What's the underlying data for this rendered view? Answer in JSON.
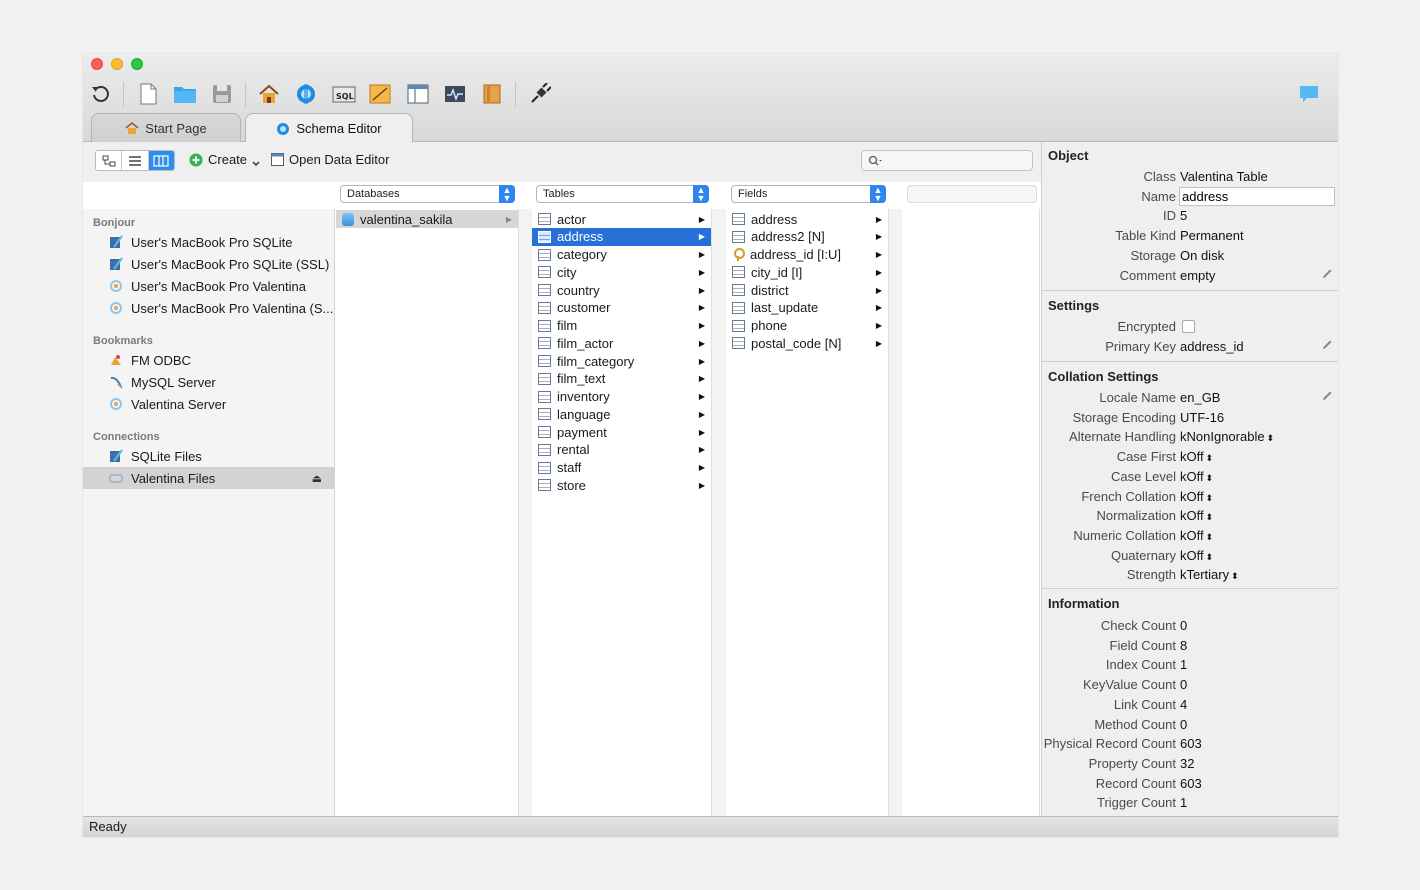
{
  "status": "Ready",
  "tabs": {
    "start": "Start Page",
    "schema": "Schema Editor"
  },
  "subtoolbar": {
    "create": "Create",
    "open_data_editor": "Open Data Editor",
    "search_placeholder": ""
  },
  "dropdowns": {
    "databases": "Databases",
    "tables": "Tables",
    "fields": "Fields"
  },
  "sidebar": {
    "sections": {
      "bonjour": "Bonjour",
      "bookmarks": "Bookmarks",
      "connections": "Connections"
    },
    "bonjour_items": [
      "User's MacBook Pro SQLite",
      "User's MacBook Pro SQLite (SSL)",
      "User's MacBook Pro Valentina",
      "User's MacBook Pro Valentina (S..."
    ],
    "bookmark_items": [
      "FM ODBC",
      "MySQL Server",
      "Valentina Server"
    ],
    "connection_items": [
      "SQLite Files",
      "Valentina Files"
    ]
  },
  "databases": [
    "valentina_sakila"
  ],
  "tables": [
    "actor",
    "address",
    "category",
    "city",
    "country",
    "customer",
    "film",
    "film_actor",
    "film_category",
    "film_text",
    "inventory",
    "language",
    "payment",
    "rental",
    "staff",
    "store"
  ],
  "fields": [
    "address",
    "address2 [N]",
    "address_id [I:U]",
    "city_id [I]",
    "district",
    "last_update",
    "phone",
    "postal_code [N]"
  ],
  "inspector": {
    "object_title": "Object",
    "object": [
      {
        "k": "Class",
        "v": "Valentina Table"
      },
      {
        "k": "Name",
        "v": "address"
      },
      {
        "k": "ID",
        "v": "5"
      },
      {
        "k": "Table Kind",
        "v": "Permanent"
      },
      {
        "k": "Storage",
        "v": "On disk"
      },
      {
        "k": "Comment",
        "v": "empty"
      }
    ],
    "settings_title": "Settings",
    "settings": [
      {
        "k": "Encrypted",
        "v": ""
      },
      {
        "k": "Primary Key",
        "v": "address_id"
      }
    ],
    "collation_title": "Collation Settings",
    "collation": [
      {
        "k": "Locale Name",
        "v": "en_GB"
      },
      {
        "k": "Storage Encoding",
        "v": "UTF-16"
      },
      {
        "k": "Alternate Handling",
        "v": "kNonIgnorable"
      },
      {
        "k": "Case First",
        "v": "kOff"
      },
      {
        "k": "Case Level",
        "v": "kOff"
      },
      {
        "k": "French Collation",
        "v": "kOff"
      },
      {
        "k": "Normalization",
        "v": "kOff"
      },
      {
        "k": "Numeric Collation",
        "v": "kOff"
      },
      {
        "k": "Quaternary",
        "v": "kOff"
      },
      {
        "k": "Strength",
        "v": "kTertiary"
      }
    ],
    "information_title": "Information",
    "information": [
      {
        "k": "Check Count",
        "v": "0"
      },
      {
        "k": "Field Count",
        "v": "8"
      },
      {
        "k": "Index Count",
        "v": "1"
      },
      {
        "k": "KeyValue Count",
        "v": "0"
      },
      {
        "k": "Link Count",
        "v": "4"
      },
      {
        "k": "Method Count",
        "v": "0"
      },
      {
        "k": "Physical Record Count",
        "v": "603"
      },
      {
        "k": "Property Count",
        "v": "32"
      },
      {
        "k": "Record Count",
        "v": "603"
      },
      {
        "k": "Trigger Count",
        "v": "1"
      }
    ]
  }
}
